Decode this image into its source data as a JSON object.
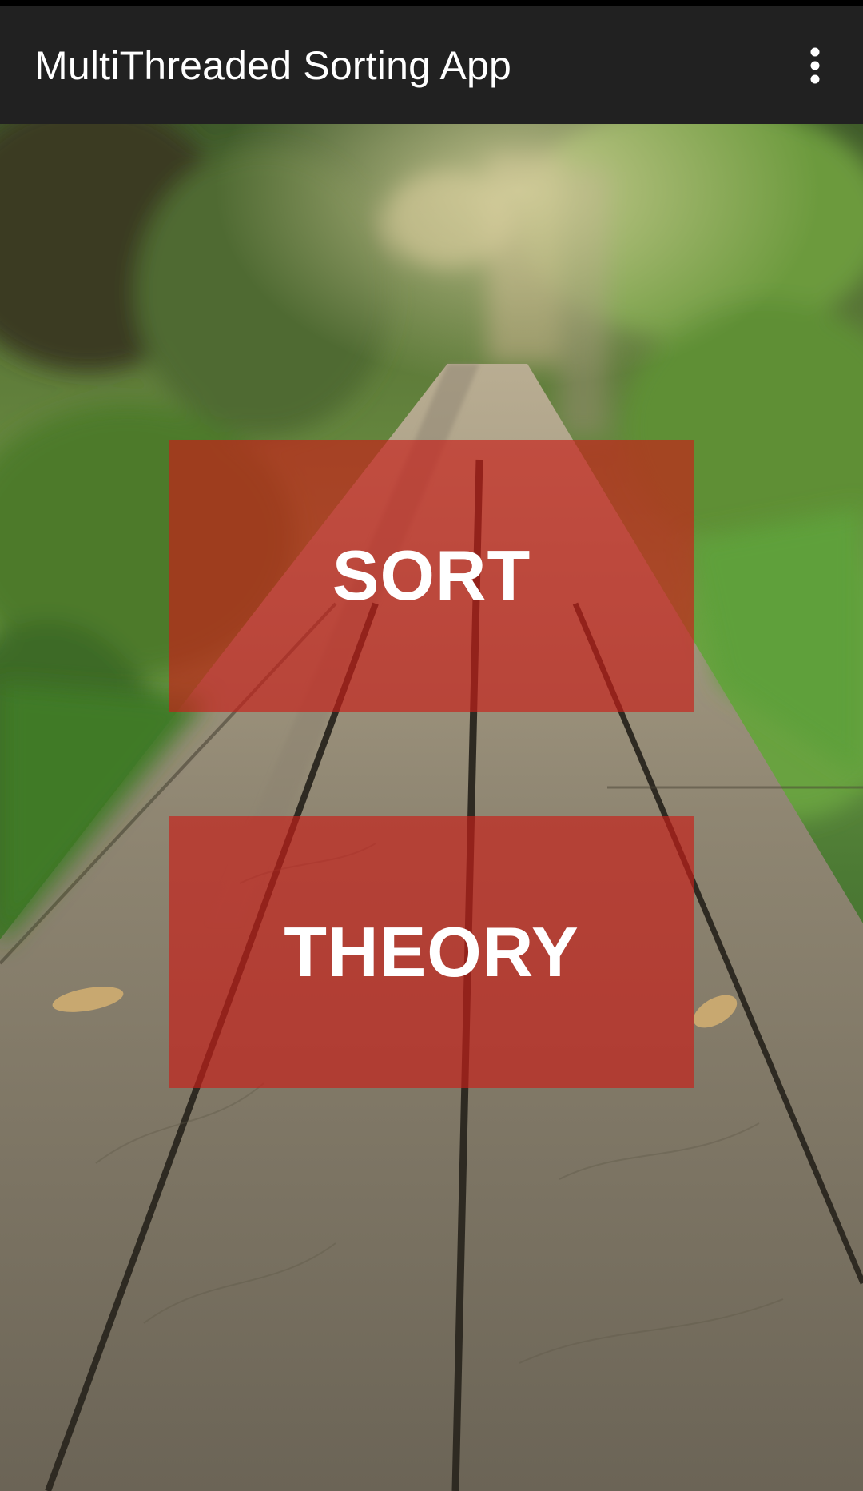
{
  "app_bar": {
    "title": "MultiThreaded Sorting App",
    "overflow_icon": "more-vert-icon"
  },
  "main": {
    "background": "blurred forest boardwalk photo",
    "buttons": [
      {
        "label": "SORT"
      },
      {
        "label": "THEORY"
      }
    ]
  },
  "colors": {
    "app_bar": "#212121",
    "button_fill": "#c81e19",
    "button_text": "#ffffff"
  }
}
